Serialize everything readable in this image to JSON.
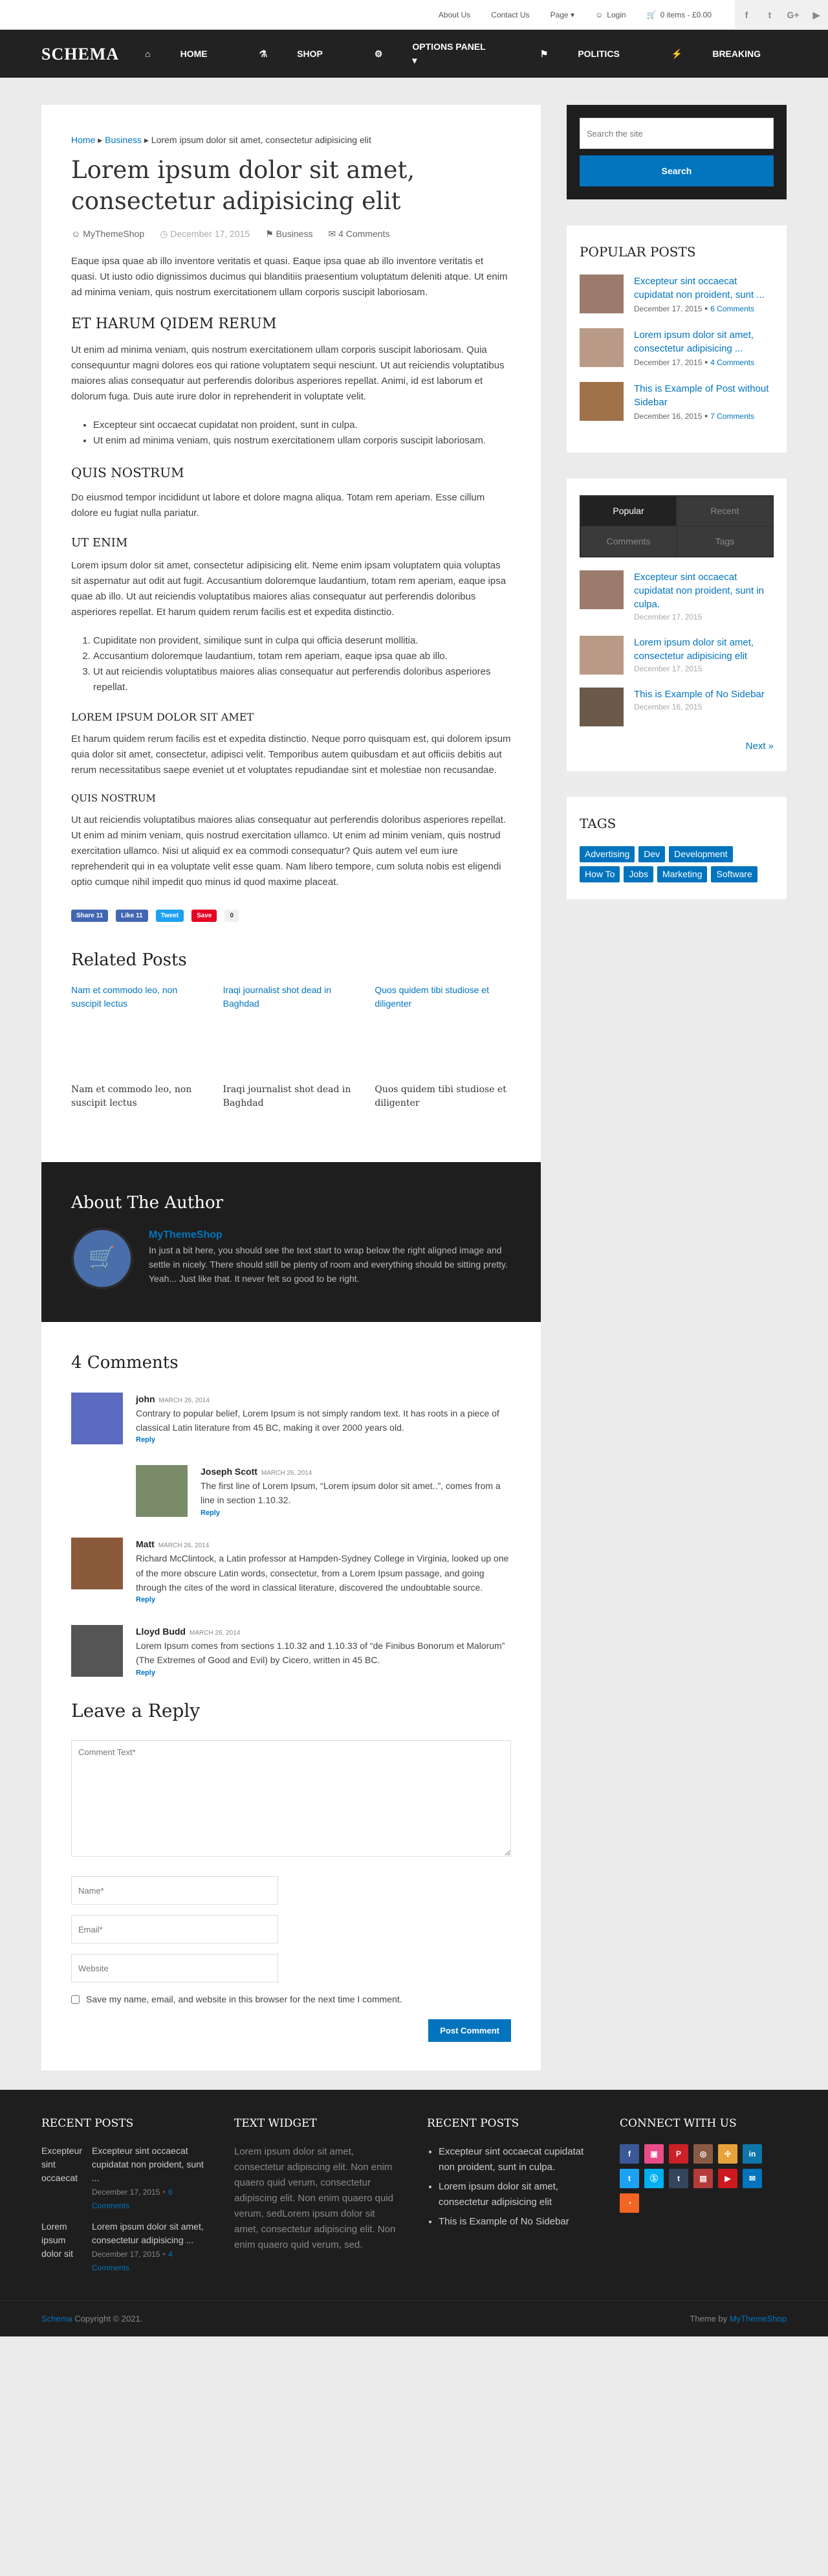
{
  "topbar": {
    "nav": [
      "About Us",
      "Contact Us",
      "Page ▾"
    ],
    "login": "Login",
    "cart": "0 items - £0.00",
    "social": [
      "f",
      "t",
      "G+",
      "▶"
    ]
  },
  "header": {
    "logo": "SCHEMA",
    "nav": [
      {
        "icon": "⌂",
        "label": "Home"
      },
      {
        "icon": "⚗",
        "label": "Shop"
      },
      {
        "icon": "⚙",
        "label": "Options Panel ▾"
      },
      {
        "icon": "⚑",
        "label": "Politics"
      },
      {
        "icon": "⚡",
        "label": "Breaking"
      }
    ]
  },
  "post": {
    "breadcrumb": {
      "home": "Home",
      "category": "Business",
      "current": "Lorem ipsum dolor sit amet, consectetur adipisicing elit"
    },
    "title": "Lorem ipsum dolor sit amet, consectetur adipisicing elit",
    "meta": {
      "author": "MyThemeShop",
      "date": "December 17, 2015",
      "category": "Business",
      "comments": "4 Comments"
    },
    "p1": "Eaque ipsa quae ab illo inventore veritatis et quasi. Eaque ipsa quae ab illo inventore veritatis et quasi. Ut iusto odio dignissimos ducimus qui blanditiis praesentium voluptatum deleniti atque. Ut enim ad minima veniam, quis nostrum exercitationem ullam corporis suscipit laboriosam.",
    "h2": "ET HARUM QIDEM RERUM",
    "p2": "Ut enim ad minima veniam, quis nostrum exercitationem ullam corporis suscipit laboriosam. Quia consequuntur magni dolores eos qui ratione voluptatem sequi nesciunt. Ut aut reiciendis voluptatibus maiores alias consequatur aut perferendis doloribus asperiores repellat. Animi, id est laborum et dolorum fuga. Duis aute irure dolor in reprehenderit in voluptate velit.",
    "ul": [
      "Excepteur sint occaecat cupidatat non proident, sunt in culpa.",
      "Ut enim ad minima veniam, quis nostrum exercitationem ullam corporis suscipit laboriosam."
    ],
    "h3": "QUIS NOSTRUM",
    "p3": "Do eiusmod tempor incididunt ut labore et dolore magna aliqua. Totam rem aperiam. Esse cillum dolore eu fugiat nulla pariatur.",
    "h4": "UT ENIM",
    "p4": "Lorem ipsum dolor sit amet, consectetur adipisicing elit. Neme enim ipsam voluptatem quia voluptas sit aspernatur aut odit aut fugit. Accusantium doloremque laudantium, totam rem aperiam, eaque ipsa quae ab illo. Ut aut reiciendis voluptatibus maiores alias consequatur aut perferendis doloribus asperiores repellat. Et harum quidem rerum facilis est et expedita distinctio.",
    "ol": [
      "Cupiditate non provident, similique sunt in culpa qui officia deserunt mollitia.",
      "Accusantium doloremque laudantium, totam rem aperiam, eaque ipsa quae ab illo.",
      "Ut aut reiciendis voluptatibus maiores alias consequatur aut perferendis doloribus asperiores repellat."
    ],
    "h5": "LOREM IPSUM DOLOR SIT AMET",
    "p5": "Et harum quidem rerum facilis est et expedita distinctio. Neque porro quisquam est, qui dolorem ipsum quia dolor sit amet, consectetur, adipisci velit. Temporibus autem quibusdam et aut officiis debitis aut rerum necessitatibus saepe eveniet ut et voluptates repudiandae sint et molestiae non recusandae.",
    "h6": "QUIS NOSTRUM",
    "p6": "Ut aut reiciendis voluptatibus maiores alias consequatur aut perferendis doloribus asperiores repellat. Ut enim ad minim veniam, quis nostrud exercitation ullamco. Ut enim ad minim veniam, quis nostrud exercitation ullamco. Nisi ut aliquid ex ea commodi consequatur? Quis autem vel eum iure reprehenderit qui in ea voluptate velit esse quam. Nam libero tempore, cum soluta nobis est eligendi optio cumque nihil impedit quo minus id quod maxime placeat.",
    "share": {
      "fb": "Share 11",
      "like": "Like 11",
      "tweet": "Tweet",
      "save": "Save",
      "count": "0"
    }
  },
  "related": {
    "title": "Related Posts",
    "items": [
      "Nam et commodo leo, non suscipit lectus",
      "Iraqi journalist shot dead in Baghdad",
      "Quos quidem tibi studiose et diligenter"
    ]
  },
  "author": {
    "heading": "About The Author",
    "name": "MyThemeShop",
    "bio": "In just a bit here, you should see the text start to wrap below the right aligned image and settle in nicely. There should still be plenty of room and everything should be sitting pretty. Yeah... Just like that. It never felt so good to be right."
  },
  "comments": {
    "heading": "4 Comments",
    "reply": "Reply",
    "items": [
      {
        "name": "john",
        "date": "MARCH 26, 2014",
        "text": "Contrary to popular belief, Lorem Ipsum is not simply random text. It has roots in a piece of classical Latin literature from 45 BC, making it over 2000 years old."
      },
      {
        "name": "Joseph Scott",
        "date": "MARCH 26, 2014",
        "text": "The first line of Lorem Ipsum, “Lorem ipsum dolor sit amet..”, comes from a line in section 1.10.32."
      },
      {
        "name": "Matt",
        "date": "MARCH 26, 2014",
        "text": "Richard McClintock, a Latin professor at Hampden-Sydney College in Virginia, looked up one of the more obscure Latin words, consectetur, from a Lorem Ipsum passage, and going through the cites of the word in classical literature, discovered the undoubtable source."
      },
      {
        "name": "Lloyd Budd",
        "date": "MARCH 26, 2014",
        "text": "Lorem Ipsum comes from sections 1.10.32 and 1.10.33 of “de Finibus Bonorum et Malorum” (The Extremes of Good and Evil) by Cicero, written in 45 BC."
      }
    ]
  },
  "form": {
    "heading": "Leave a Reply",
    "comment_placeholder": "Comment Text*",
    "name_placeholder": "Name*",
    "email_placeholder": "Email*",
    "website_placeholder": "Website",
    "consent": "Save my name, email, and website in this browser for the next time I comment.",
    "submit": "Post Comment"
  },
  "sidebar": {
    "search_placeholder": "Search the site",
    "search_button": "Search",
    "popular": {
      "heading": "Popular Posts",
      "items": [
        {
          "title": "Excepteur sint occaecat cupidatat non proident, sunt ...",
          "date": "December 17, 2015",
          "comments": "6 Comments"
        },
        {
          "title": "Lorem ipsum dolor sit amet, consectetur adipisicing ...",
          "date": "December 17, 2015",
          "comments": "4 Comments"
        },
        {
          "title": "This is Example of Post without Sidebar",
          "date": "December 16, 2015",
          "comments": "7 Comments"
        }
      ]
    },
    "tabs": {
      "labels": [
        "Popular",
        "Recent",
        "Comments",
        "Tags"
      ],
      "items": [
        {
          "title": "Excepteur sint occaecat cupidatat non proident, sunt in culpa.",
          "date": "December 17, 2015"
        },
        {
          "title": "Lorem ipsum dolor sit amet, consectetur adipisicing elit",
          "date": "December 17, 2015"
        },
        {
          "title": "This is Example of No Sidebar",
          "date": "December 16, 2015"
        }
      ],
      "next": "Next »"
    },
    "tags": {
      "heading": "Tags",
      "items": [
        "Advertising",
        "Dev",
        "Development",
        "How To",
        "Jobs",
        "Marketing",
        "Software"
      ]
    }
  },
  "footer": {
    "recent": {
      "heading": "Recent Posts",
      "items": [
        {
          "thumb": "Excepteur sint occaecat cupidatat non",
          "title": "Excepteur sint occaecat cupidatat non proident, sunt ...",
          "date": "December 17, 2015",
          "comments": "6 Comments"
        },
        {
          "thumb": "Lorem ipsum dolor sit amet, consectetur",
          "title": "Lorem ipsum dolor sit amet, consectetur adipisicing ...",
          "date": "December 17, 2015",
          "comments": "4 Comments"
        }
      ]
    },
    "text_widget": {
      "heading": "Text Widget",
      "text": "Lorem ipsum dolor sit amet, consectetur adipiscing elit. Non enim quaero quid verum, consectetur adipiscing elit. Non enim quaero quid verum, sedLorem ipsum dolor sit amet, consectetur adipiscing elit. Non enim quaero quid verum, sed."
    },
    "list": {
      "heading": "Recent Posts",
      "items": [
        "Excepteur sint occaecat cupidatat non proident, sunt in culpa.",
        "Lorem ipsum dolor sit amet, consectetur adipisicing elit",
        "This is Example of No Sidebar"
      ]
    },
    "connect": {
      "heading": "Connect With Us",
      "icons": [
        {
          "glyph": "f",
          "color": "#3b5998"
        },
        {
          "glyph": "▣",
          "color": "#ea4c89"
        },
        {
          "glyph": "P",
          "color": "#cb2027"
        },
        {
          "glyph": "◎",
          "color": "#8a5a44"
        },
        {
          "glyph": "✣",
          "color": "#e8a23a"
        },
        {
          "glyph": "in",
          "color": "#0e76a8"
        },
        {
          "glyph": "t",
          "color": "#1da1f2"
        },
        {
          "glyph": "Ⓢ",
          "color": "#00aff0"
        },
        {
          "glyph": "t",
          "color": "#35465c"
        },
        {
          "glyph": "▤",
          "color": "#b53b3b"
        },
        {
          "glyph": "▶",
          "color": "#cc181e"
        },
        {
          "glyph": "✉",
          "color": "#0274be"
        },
        {
          "glyph": "◔",
          "color": "#f26522"
        }
      ]
    }
  },
  "copyright": {
    "brand": "Schema",
    "text": " Copyright © 2021.",
    "theme_prefix": "Theme by ",
    "theme_link": "MyThemeShop"
  }
}
